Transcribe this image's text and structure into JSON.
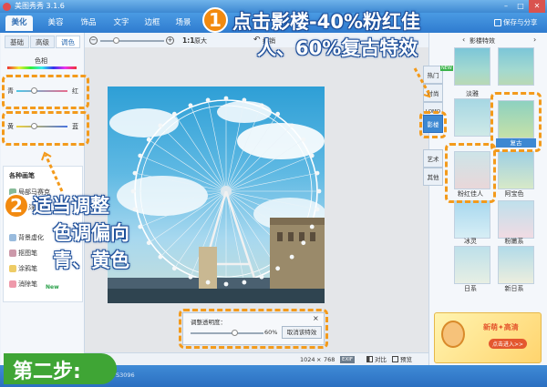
{
  "app": {
    "title": "美图秀秀 3.1.6"
  },
  "toolbar": {
    "tabs": [
      "美化",
      "美容",
      "饰品",
      "文字",
      "边框",
      "场景"
    ],
    "save_label": "保存与分享"
  },
  "left_panel": {
    "subtabs": [
      "基础",
      "高级",
      "调色"
    ],
    "hue_label": "色相",
    "slider1": {
      "left": "青",
      "right": "红",
      "level": 0.35
    },
    "slider2": {
      "left": "黄",
      "right": "蓝",
      "level": 0.35
    },
    "brush_title": "各种画笔",
    "tools": [
      "局部马赛克",
      "局部彩色笔",
      "背景虚化",
      "抠图笔",
      "涂鸦笔",
      "消除笔"
    ],
    "new_badge": "New"
  },
  "canvas_toolbar": {
    "size_label": "1:1",
    "original_label": "原大",
    "undo_label": "撤销",
    "redo_label": "重做"
  },
  "fade_panel": {
    "label": "调整透明度：",
    "value": "60%",
    "cancel_label": "取消该特效",
    "level": 0.6
  },
  "right_panel": {
    "header": "影楼特效",
    "side_tabs": [
      "热门",
      "时尚",
      "LOMO",
      "影楼",
      "艺术",
      "其他"
    ],
    "new_badge": "NEW",
    "effects": [
      "淡雅",
      "复古",
      "粉红佳人",
      "阿宝色",
      "冰灵",
      "粉嫩系",
      "日系",
      "新日系"
    ],
    "ad_text": "新萌✦高清",
    "ad_sub": "点击进入>>"
  },
  "bottom_bar": {
    "width": "1024",
    "times": "×",
    "height": "768",
    "exif": "EXIF",
    "compare": "对比",
    "preview": "预览"
  },
  "status": {
    "step_label": "第二步:",
    "code": "TS3096"
  },
  "annotations": {
    "step1_num": "1",
    "step1_line1": "点击影楼-40%粉红佳",
    "step1_line2": "人、60%复古特效",
    "step2_num": "2",
    "step2_line1": "适当调整",
    "step2_line2": "色调偏向",
    "step2_line3": "青、黄色"
  },
  "colors": {
    "accent": "#3d88d2",
    "highlight": "#f39a1b"
  }
}
